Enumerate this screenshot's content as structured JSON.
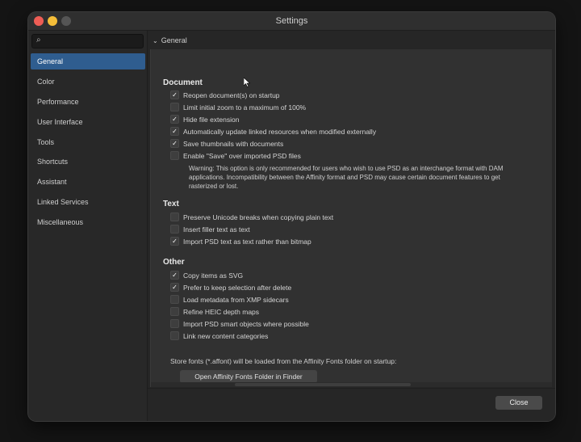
{
  "window": {
    "title": "Settings"
  },
  "sidebar": {
    "items": [
      {
        "label": "General",
        "active": true
      },
      {
        "label": "Color"
      },
      {
        "label": "Performance"
      },
      {
        "label": "User Interface"
      },
      {
        "label": "Tools"
      },
      {
        "label": "Shortcuts"
      },
      {
        "label": "Assistant"
      },
      {
        "label": "Linked Services"
      },
      {
        "label": "Miscellaneous"
      }
    ],
    "search_icon": "search-icon"
  },
  "main": {
    "section": "General",
    "document": {
      "title": "Document",
      "options": [
        {
          "label": "Reopen document(s) on startup",
          "checked": true
        },
        {
          "label": "Limit initial zoom to a maximum of 100%",
          "checked": false
        },
        {
          "label": "Hide file extension",
          "checked": true
        },
        {
          "label": "Automatically update linked resources when modified externally",
          "checked": true
        },
        {
          "label": "Save thumbnails with documents",
          "checked": true
        },
        {
          "label": "Enable \"Save\" over imported PSD files",
          "checked": false
        }
      ],
      "warning": "Warning: This option is only recommended for users who wish to use PSD as an interchange format with DAM applications. Incompatibility between the Affinity format and PSD may cause certain document features to get rasterized or lost."
    },
    "text": {
      "title": "Text",
      "options": [
        {
          "label": "Preserve Unicode breaks when copying plain text",
          "checked": false
        },
        {
          "label": "Insert filler text as text",
          "checked": false
        },
        {
          "label": "Import PSD text as text rather than bitmap",
          "checked": true
        }
      ]
    },
    "other": {
      "title": "Other",
      "options": [
        {
          "label": "Copy items as SVG",
          "checked": true
        },
        {
          "label": "Prefer to keep selection after delete",
          "checked": true
        },
        {
          "label": "Load metadata from XMP sidecars",
          "checked": false
        },
        {
          "label": "Refine HEIC depth maps",
          "checked": false
        },
        {
          "label": "Import PSD smart objects where possible",
          "checked": false
        },
        {
          "label": "Link new content categories",
          "checked": false
        }
      ]
    },
    "fonts_note": "Store fonts (*.affont) will be loaded from the Affinity Fonts folder on startup:",
    "open_fonts_button": "Open Affinity Fonts Folder in Finder"
  },
  "footer": {
    "close_label": "Close"
  },
  "colors": {
    "accent": "#2f5d8f",
    "close_red": "#ee5d55",
    "minimize_yellow": "#f4bd39"
  }
}
